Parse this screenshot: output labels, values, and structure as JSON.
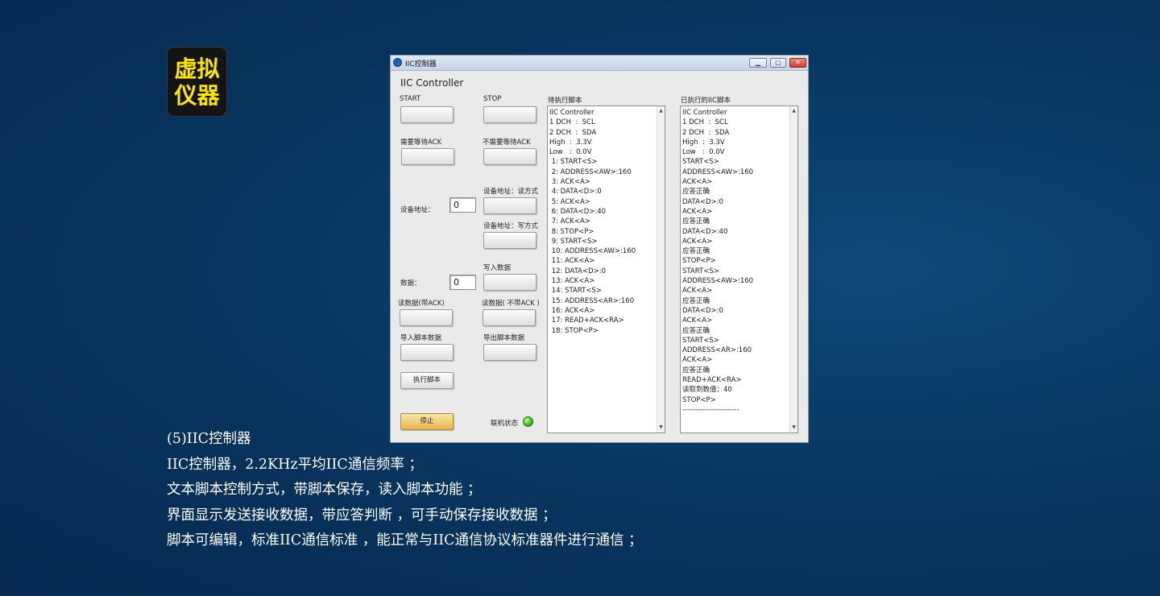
{
  "badge": {
    "line1": "虚拟",
    "line2": "仪器"
  },
  "window": {
    "title": "IIC控制器",
    "min_glyph": "▁",
    "max_glyph": "□",
    "close_glyph": "✕"
  },
  "panel": {
    "title": "IIC Controller",
    "start_label": "START",
    "stop_label": "STOP",
    "wait_ack_label": "需要等待ACK",
    "no_wait_ack_label": "不需要等待ACK",
    "dev_addr_read_label": "设备地址：读方式",
    "dev_addr_label": "设备地址：",
    "dev_addr_value": "0",
    "dev_addr_write_label": "设备地址：写方式",
    "write_data_label": "写入数据",
    "data_label": "数据：",
    "data_value": "0",
    "read_ack_label": "读数据(带ACK)",
    "read_noack_label": "读数据( 不带ACK )",
    "import_label": "导入脚本数据",
    "export_label": "导出脚本数据",
    "run_button": "执行脚本",
    "stop_button": "停止",
    "online_label": "联机状态"
  },
  "pending_script": {
    "header": "待执行脚本",
    "lines": [
      "IIC Controller",
      "1 DCH  :  SCL",
      "2 DCH  :  SDA",
      "High  :  3.3V",
      "Low   :  0.0V",
      " 1: START<S>",
      " 2: ADDRESS<AW>:160",
      " 3: ACK<A>",
      " 4: DATA<D>:0",
      " 5: ACK<A>",
      " 6: DATA<D>:40",
      " 7: ACK<A>",
      " 8: STOP<P>",
      " 9: START<S>",
      " 10: ADDRESS<AW>:160",
      " 11: ACK<A>",
      " 12: DATA<D>:0",
      " 13: ACK<A>",
      " 14: START<S>",
      " 15: ADDRESS<AR>:160",
      " 16: ACK<A>",
      " 17: READ+ACK<RA>",
      " 18: STOP<P>"
    ]
  },
  "executed_script": {
    "header": "已执行的IIC脚本",
    "lines": [
      "IIC Controller",
      "1 DCH  :  SCL",
      "2 DCH  :  SDA",
      "High  :  3.3V",
      "Low   :  0.0V",
      "START<S>",
      "ADDRESS<AW>:160",
      "ACK<A>",
      "应答正确",
      "DATA<D>:0",
      "ACK<A>",
      "应答正确",
      "DATA<D>:40",
      "ACK<A>",
      "应答正确",
      "STOP<P>",
      "START<S>",
      "ADDRESS<AW>:160",
      "ACK<A>",
      "应答正确",
      "DATA<D>:0",
      "ACK<A>",
      "应答正确",
      "START<S>",
      "ADDRESS<AR>:160",
      "ACK<A>",
      "应答正确",
      "READ+ACK<RA>",
      "读取到数值：40",
      "STOP<P>",
      "-----------------------"
    ]
  },
  "description": {
    "heading": "(5)IIC控制器",
    "items": [
      "IIC控制器，2.2KHz平均IIC通信频率 ；",
      "文本脚本控制方式，带脚本保存，读入脚本功能 ；",
      "界面显示发送接收数据，带应答判断 ，可手动保存接收数据 ；",
      "脚本可编辑，标准IIC通信标准 ，能正常与IIC通信协议标准器件进行通信 ；"
    ]
  }
}
